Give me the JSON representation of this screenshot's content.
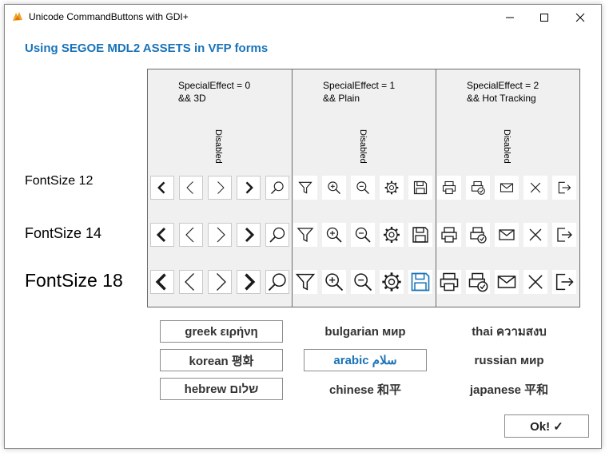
{
  "window": {
    "title": "Unicode CommandButtons with GDI+",
    "controls": [
      "minimize-icon",
      "maximize-icon",
      "close-icon"
    ]
  },
  "heading": "Using SEGOE MDL2 ASSETS in VFP forms",
  "row_labels": [
    "FontSize 12",
    "FontSize 14",
    "FontSize 18"
  ],
  "columns": [
    {
      "header": "SpecialEffect = 0\n&& 3D",
      "disabled_label": "Disabled",
      "icons": [
        "chevron-left-bold-icon",
        "chevron-left-icon",
        "chevron-right-icon",
        "chevron-right-bold-icon",
        "search-icon"
      ]
    },
    {
      "header": "SpecialEffect = 1\n&& Plain",
      "disabled_label": "Disabled",
      "icons": [
        "filter-icon",
        "zoom-in-icon",
        "zoom-out-icon",
        "gear-icon",
        "save-icon"
      ]
    },
    {
      "header": "SpecialEffect = 2\n&& Hot Tracking",
      "disabled_label": "Disabled",
      "icons": [
        "print-icon",
        "print-settings-icon",
        "mail-icon",
        "close-x-icon",
        "sign-out-icon"
      ]
    }
  ],
  "languages": [
    {
      "label": "greek ειρήνη",
      "style": "boxed"
    },
    {
      "label": "bulgarian мир",
      "style": "flat"
    },
    {
      "label": "thai ความสงบ",
      "style": "flat"
    },
    {
      "label": "korean 평화",
      "style": "boxed"
    },
    {
      "label": "arabic سلام",
      "style": "selected"
    },
    {
      "label": "russian мир",
      "style": "flat"
    },
    {
      "label": "hebrew שלום",
      "style": "boxed"
    },
    {
      "label": "chinese 和平",
      "style": "flat"
    },
    {
      "label": "japanese 平和",
      "style": "flat"
    }
  ],
  "ok_button": "Ok! ✓",
  "colors": {
    "accent": "#1a73b8",
    "grid_bg": "#f0f0f0"
  }
}
